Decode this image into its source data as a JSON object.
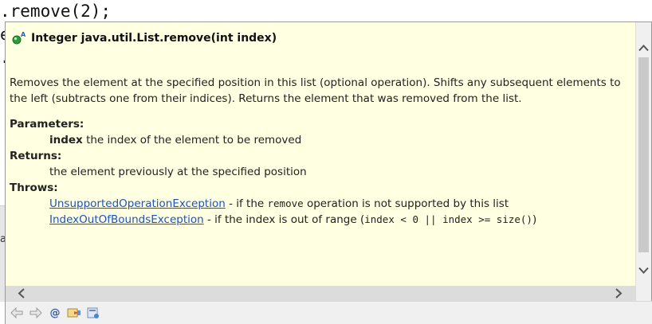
{
  "editor": {
    "code_line": ".remove(2);",
    "frag1": "e",
    "frag2": ".",
    "side_letter": "a"
  },
  "popup": {
    "title": "Integer java.util.List.remove(int index)",
    "description": "Removes the element at the specified position in this list (optional operation). Shifts any subsequent elements to the left (subtracts one from their indices). Returns the element that was removed from the list.",
    "parameters_label": "Parameters:",
    "param_name": "index",
    "param_desc": "the index of the element to be removed",
    "returns_label": "Returns:",
    "returns_desc": "the element previously at the specified position",
    "throws_label": "Throws:",
    "throws": [
      {
        "exception": "UnsupportedOperationException",
        "pre": "- if the",
        "code": "remove",
        "post": "operation is not supported by this list"
      },
      {
        "exception": "IndexOutOfBoundsException",
        "pre": "- if the index is out of range (",
        "code": "index < 0 || index >= size()",
        "post": ")"
      }
    ]
  },
  "toolbar": {
    "icons": [
      "back-icon",
      "forward-icon",
      "at-icon",
      "open-declaration-icon",
      "open-attached-javadoc-icon"
    ]
  },
  "colors": {
    "popup_bg": "#ffffe1",
    "link": "#1a52c4"
  }
}
